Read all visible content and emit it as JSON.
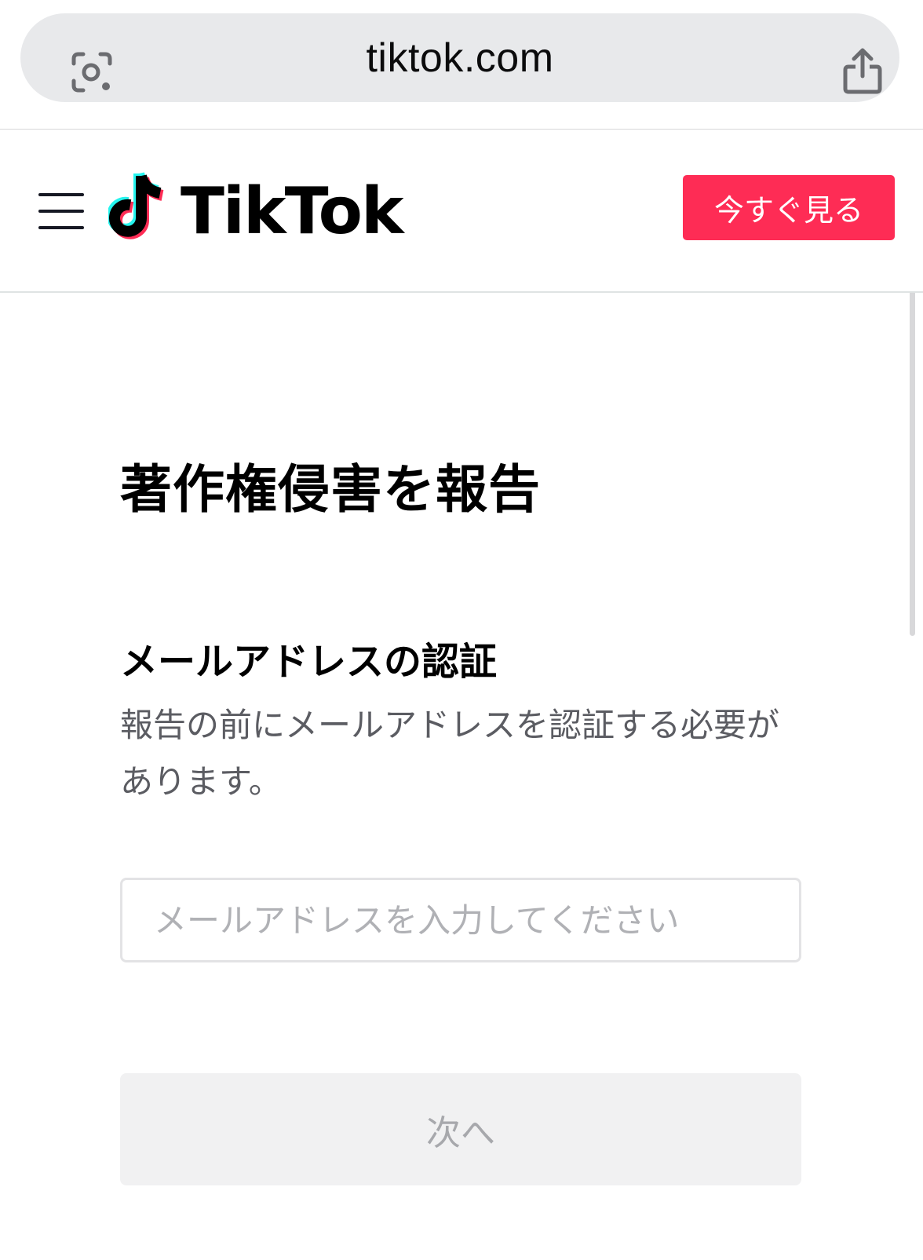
{
  "browser": {
    "url": "tiktok.com",
    "icons": {
      "left": "visual-search-icon",
      "right": "share-icon"
    }
  },
  "header": {
    "menu_icon": "hamburger-menu-icon",
    "logo_icon": "tiktok-note-icon",
    "brand": "TikTok",
    "cta_label": "今すぐ見る",
    "cta_color": "#fe2c55"
  },
  "main": {
    "title": "著作権侵害を報告",
    "section_title": "メールアドレスの認証",
    "section_desc": "報告の前にメールアドレスを認証する必要があります。",
    "email_placeholder": "メールアドレスを入力してください",
    "email_value": "",
    "next_label": "次へ"
  }
}
